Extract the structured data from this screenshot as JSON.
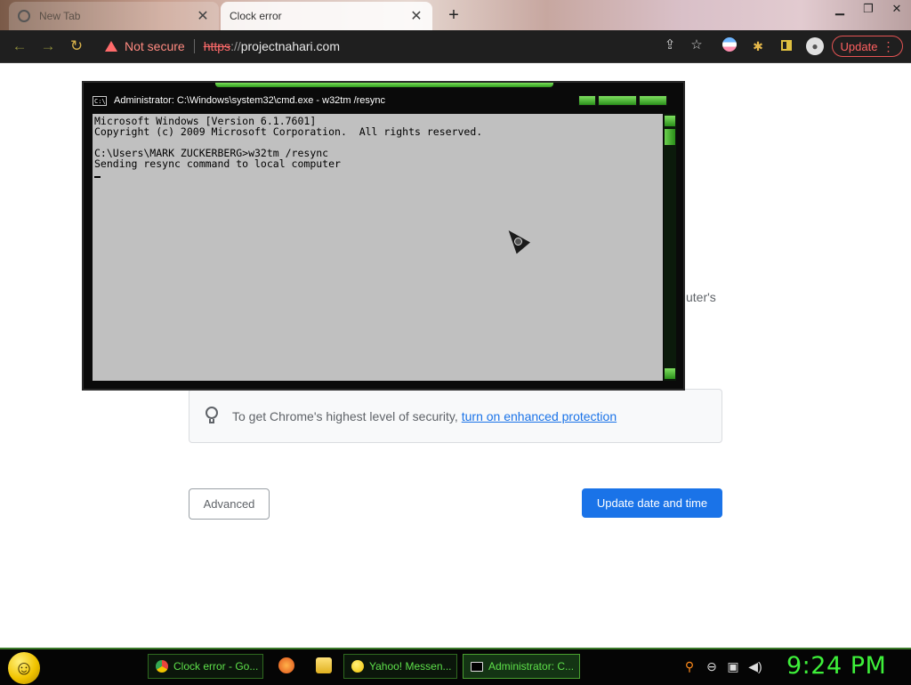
{
  "browser": {
    "tabs": [
      {
        "title": "New Tab",
        "active": false
      },
      {
        "title": "Clock error",
        "active": true
      }
    ],
    "address": {
      "security_label": "Not secure",
      "scheme": "https",
      "separator": "://",
      "host": "projectnahari.com"
    },
    "update_label": "Update"
  },
  "page": {
    "partial_text": "uter's",
    "security_tip": {
      "text": "To get Chrome's highest level of security,",
      "link": "turn on enhanced protection"
    },
    "advanced_label": "Advanced",
    "primary_label": "Update date and time"
  },
  "cmd": {
    "icon_text": "C:\\",
    "title": "Administrator: C:\\Windows\\system32\\cmd.exe - w32tm  /resync",
    "lines": [
      "Microsoft Windows [Version 6.1.7601]",
      "Copyright (c) 2009 Microsoft Corporation.  All rights reserved.",
      "",
      "C:\\Users\\MARK ZUCKERBERG>w32tm /resync",
      "Sending resync command to local computer"
    ]
  },
  "taskbar": {
    "buttons": [
      {
        "label": "Clock error - Go...",
        "icon_color": "#e8453c"
      },
      {
        "label": "Yahoo! Messen...",
        "icon_color": "#f1c400"
      },
      {
        "label": "Administrator: C...",
        "icon_color": "#dddddd"
      }
    ],
    "clock": "9:24 PM"
  },
  "colors": {
    "accent_blue": "#1a73e8",
    "terminal_green": "#3ef03a",
    "warning_red": "#ff6b6b"
  }
}
